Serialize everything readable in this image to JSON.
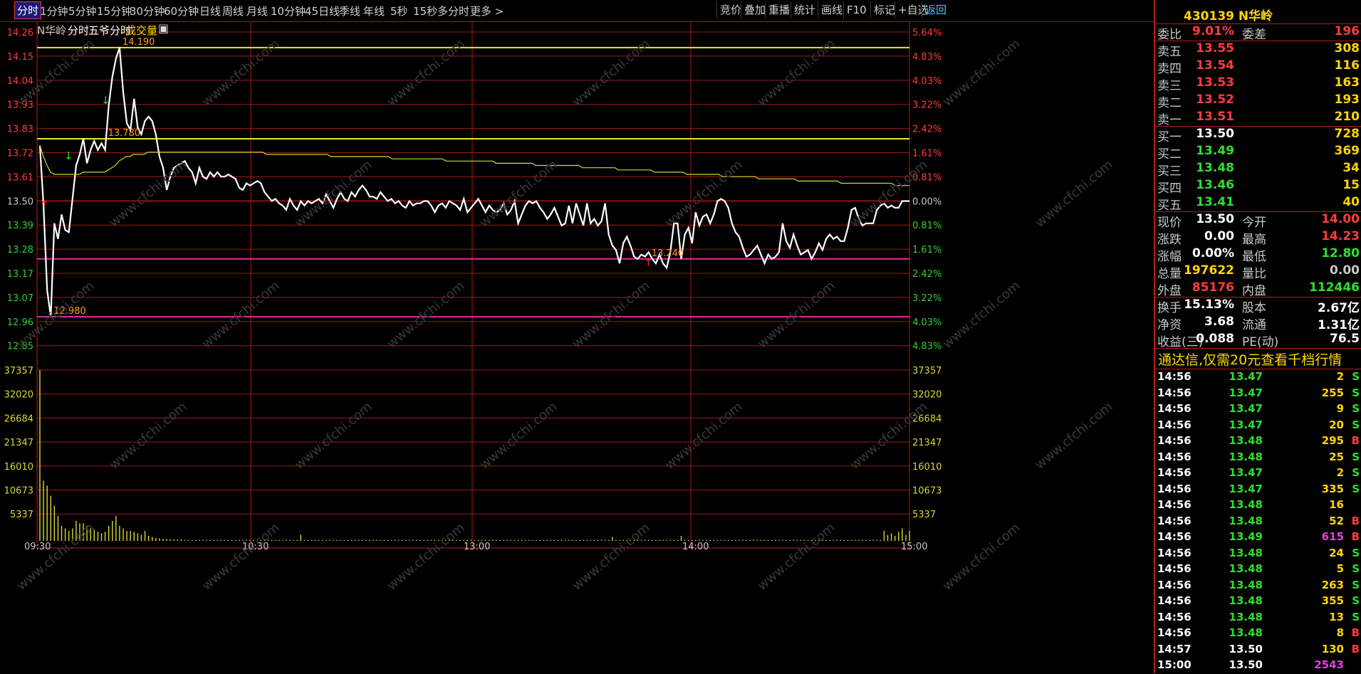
{
  "top_tabs": [
    "分时",
    "1分钟",
    "5分钟",
    "15分钟",
    "30分钟",
    "60分钟",
    "日线",
    "周线",
    "月线",
    "10分钟",
    "45日线",
    "季线",
    "年线",
    "5秒",
    "15秒",
    "多分时",
    "更多 >"
  ],
  "right_buttons": [
    "竞价",
    "叠加",
    "重播",
    "统计",
    "画线",
    "F10",
    "标记",
    "+自选",
    "返回"
  ],
  "header": {
    "name": "N华岭",
    "mode": "分时",
    "five_fen": "五爷分时",
    "volume_label": "成交量"
  },
  "chart_data": {
    "type": "line",
    "price_axis_left": [
      "14.26",
      "14.15",
      "14.04",
      "13.93",
      "13.83",
      "13.72",
      "13.61",
      "13.50",
      "13.39",
      "13.28",
      "13.17",
      "13.07",
      "12.96",
      "12.85"
    ],
    "pct_axis_right": [
      "5.64%",
      "4.83%",
      "4.03%",
      "3.22%",
      "2.42%",
      "1.61%",
      "0.81%",
      "0.00%",
      "0.81%",
      "1.61%",
      "2.42%",
      "3.22%",
      "4.03%",
      "4.83%"
    ],
    "vol_axis": [
      "37357",
      "32020",
      "26684",
      "21347",
      "16010",
      "10673",
      "5337"
    ],
    "time_labels": [
      "09:30",
      "10:30",
      "13:00",
      "14:00",
      "15:00"
    ],
    "prev_close": 13.5,
    "price_range": [
      12.8,
      14.32
    ],
    "annotations": [
      {
        "text": "14.190",
        "price": 14.19,
        "index": 22
      },
      {
        "text": "13.780",
        "price": 13.78,
        "index": 18
      },
      {
        "text": "13.240",
        "price": 13.24,
        "index": 168
      },
      {
        "text": "12.980",
        "price": 12.98,
        "index": 3
      }
    ],
    "series": [
      {
        "color": "#ffffff",
        "values": [
          13.75,
          13.48,
          13.1,
          12.98,
          13.4,
          13.33,
          13.44,
          13.37,
          13.36,
          13.51,
          13.66,
          13.71,
          13.78,
          13.67,
          13.73,
          13.77,
          13.73,
          13.76,
          13.73,
          13.93,
          14.06,
          14.14,
          14.19,
          13.99,
          13.85,
          13.82,
          13.96,
          13.83,
          13.8,
          13.86,
          13.88,
          13.86,
          13.8,
          13.7,
          13.65,
          13.55,
          13.61,
          13.65,
          13.66,
          13.67,
          13.68,
          13.65,
          13.63,
          13.58,
          13.65,
          13.61,
          13.6,
          13.63,
          13.61,
          13.63,
          13.61,
          13.61,
          13.62,
          13.61,
          13.6,
          13.56,
          13.55,
          13.58,
          13.57,
          13.58,
          13.59,
          13.58,
          13.54,
          13.52,
          13.5,
          13.51,
          13.49,
          13.48,
          13.46,
          13.51,
          13.48,
          13.46,
          13.5,
          13.48,
          13.5,
          13.49,
          13.5,
          13.51,
          13.49,
          13.53,
          13.5,
          13.47,
          13.51,
          13.54,
          13.51,
          13.5,
          13.54,
          13.52,
          13.55,
          13.57,
          13.55,
          13.52,
          13.52,
          13.51,
          13.54,
          13.52,
          13.5,
          13.51,
          13.49,
          13.5,
          13.48,
          13.47,
          13.5,
          13.48,
          13.49,
          13.49,
          13.5,
          13.5,
          13.48,
          13.45,
          13.48,
          13.49,
          13.47,
          13.5,
          13.49,
          13.48,
          13.46,
          13.51,
          13.45,
          13.47,
          13.49,
          13.51,
          13.48,
          13.45,
          13.48,
          13.46,
          13.45,
          13.46,
          13.49,
          13.44,
          13.46,
          13.5,
          13.4,
          13.44,
          13.48,
          13.5,
          13.49,
          13.5,
          13.47,
          13.45,
          13.42,
          13.44,
          13.47,
          13.43,
          13.39,
          13.4,
          13.48,
          13.4,
          13.49,
          13.44,
          13.39,
          13.49,
          13.4,
          13.42,
          13.39,
          13.41,
          13.49,
          13.35,
          13.3,
          13.28,
          13.22,
          13.31,
          13.34,
          13.3,
          13.25,
          13.24,
          13.26,
          13.25,
          13.27,
          13.24,
          13.22,
          13.26,
          13.22,
          13.2,
          13.27,
          13.4,
          13.4,
          13.24,
          13.35,
          13.38,
          13.31,
          13.45,
          13.39,
          13.43,
          13.44,
          13.4,
          13.44,
          13.5,
          13.51,
          13.5,
          13.47,
          13.4,
          13.36,
          13.34,
          13.29,
          13.25,
          13.26,
          13.28,
          13.3,
          13.26,
          13.22,
          13.26,
          13.24,
          13.25,
          13.27,
          13.4,
          13.32,
          13.29,
          13.35,
          13.3,
          13.26,
          13.27,
          13.28,
          13.24,
          13.27,
          13.31,
          13.28,
          13.33,
          13.35,
          13.33,
          13.34,
          13.32,
          13.32,
          13.38,
          13.46,
          13.47,
          13.42,
          13.39,
          13.4,
          13.4,
          13.4,
          13.46,
          13.48,
          13.49,
          13.47,
          13.48,
          13.47,
          13.47,
          13.5,
          13.5,
          13.5
        ]
      },
      {
        "color": "#d8d830",
        "values": [
          13.75,
          13.7,
          13.66,
          13.63,
          13.62,
          13.62,
          13.62,
          13.62,
          13.62,
          13.62,
          13.62,
          13.62,
          13.63,
          13.63,
          13.63,
          13.63,
          13.63,
          13.63,
          13.63,
          13.64,
          13.65,
          13.66,
          13.68,
          13.69,
          13.7,
          13.7,
          13.71,
          13.71,
          13.71,
          13.71,
          13.72,
          13.72,
          13.72,
          13.72,
          13.72,
          13.72,
          13.72,
          13.72,
          13.72,
          13.72,
          13.72,
          13.72,
          13.72,
          13.72,
          13.72,
          13.72,
          13.72,
          13.72,
          13.72,
          13.72,
          13.72,
          13.72,
          13.72,
          13.72,
          13.72,
          13.72,
          13.72,
          13.72,
          13.72,
          13.72,
          13.72,
          13.72,
          13.72,
          13.71,
          13.71,
          13.71,
          13.71,
          13.71,
          13.71,
          13.71,
          13.71,
          13.71,
          13.71,
          13.71,
          13.71,
          13.71,
          13.71,
          13.71,
          13.71,
          13.71,
          13.71,
          13.7,
          13.7,
          13.7,
          13.7,
          13.7,
          13.7,
          13.7,
          13.7,
          13.7,
          13.7,
          13.7,
          13.7,
          13.7,
          13.7,
          13.7,
          13.7,
          13.7,
          13.69,
          13.69,
          13.69,
          13.69,
          13.69,
          13.69,
          13.69,
          13.69,
          13.69,
          13.69,
          13.69,
          13.69,
          13.69,
          13.69,
          13.69,
          13.68,
          13.68,
          13.68,
          13.68,
          13.68,
          13.68,
          13.68,
          13.68,
          13.68,
          13.68,
          13.68,
          13.68,
          13.68,
          13.68,
          13.67,
          13.67,
          13.67,
          13.67,
          13.67,
          13.67,
          13.67,
          13.67,
          13.67,
          13.67,
          13.67,
          13.66,
          13.66,
          13.66,
          13.66,
          13.66,
          13.66,
          13.66,
          13.66,
          13.66,
          13.66,
          13.66,
          13.66,
          13.66,
          13.65,
          13.65,
          13.65,
          13.65,
          13.65,
          13.65,
          13.65,
          13.65,
          13.65,
          13.65,
          13.64,
          13.64,
          13.64,
          13.64,
          13.64,
          13.64,
          13.64,
          13.64,
          13.64,
          13.64,
          13.63,
          13.63,
          13.63,
          13.63,
          13.63,
          13.63,
          13.63,
          13.63,
          13.63,
          13.62,
          13.62,
          13.62,
          13.62,
          13.62,
          13.62,
          13.62,
          13.62,
          13.62,
          13.62,
          13.61,
          13.61,
          13.61,
          13.61,
          13.61,
          13.61,
          13.61,
          13.61,
          13.61,
          13.61,
          13.6,
          13.6,
          13.6,
          13.6,
          13.6,
          13.6,
          13.6,
          13.6,
          13.6,
          13.6,
          13.6,
          13.59,
          13.59,
          13.59,
          13.59,
          13.59,
          13.59,
          13.59,
          13.59,
          13.59,
          13.59,
          13.59,
          13.59,
          13.58,
          13.58,
          13.58,
          13.58,
          13.58,
          13.58,
          13.58,
          13.58,
          13.58,
          13.58,
          13.58,
          13.58,
          13.58,
          13.58,
          13.58,
          13.57,
          13.57,
          13.57,
          13.57,
          13.57
        ]
      }
    ],
    "volume": [
      34000,
      12000,
      11000,
      9000,
      7000,
      5000,
      3000,
      2500,
      2000,
      2500,
      4000,
      3500,
      3500,
      3000,
      2500,
      2200,
      1800,
      1500,
      1800,
      3000,
      4000,
      5000,
      3000,
      2500,
      2000,
      2000,
      1800,
      1500,
      1200,
      2000,
      1000,
      800,
      600,
      500,
      400,
      400,
      300,
      300,
      300,
      300,
      200,
      200,
      200,
      200,
      200,
      200,
      200,
      200,
      200,
      200,
      200,
      200,
      200,
      200,
      200,
      200,
      200,
      200,
      200,
      200,
      200,
      200,
      200,
      200,
      200,
      200,
      200,
      200,
      200,
      200,
      200,
      200,
      1200,
      200,
      200,
      200,
      200,
      200,
      200,
      200,
      200,
      200,
      200,
      200,
      200,
      200,
      200,
      200,
      200,
      200,
      200,
      200,
      200,
      200,
      200,
      200,
      200,
      200,
      200,
      200,
      200,
      200,
      200,
      200,
      200,
      200,
      200,
      200,
      200,
      200,
      200,
      200,
      200,
      200,
      200,
      200,
      200,
      200,
      200,
      200,
      200,
      200,
      200,
      200,
      200,
      200,
      200,
      200,
      200,
      200,
      200,
      200,
      200,
      200,
      200,
      200,
      200,
      200,
      200,
      200,
      200,
      200,
      200,
      200,
      200,
      200,
      200,
      200,
      200,
      200,
      200,
      200,
      200,
      200,
      200,
      200,
      200,
      200,
      800,
      200,
      200,
      200,
      200,
      200,
      200,
      200,
      200,
      200,
      200,
      200,
      200,
      200,
      200,
      200,
      200,
      200,
      200,
      1000,
      200,
      200,
      200,
      200,
      200,
      200,
      200,
      200,
      200,
      200,
      200,
      200,
      200,
      200,
      200,
      200,
      200,
      200,
      200,
      200,
      200,
      200,
      200,
      200,
      200,
      200,
      200,
      200,
      200,
      200,
      200,
      200,
      200,
      200,
      200,
      200,
      200,
      200,
      200,
      200,
      200,
      200,
      200,
      200,
      200,
      200,
      200,
      200,
      200,
      200,
      200,
      200,
      200,
      200,
      200,
      2000,
      1200,
      1500,
      1000,
      1800,
      2500,
      1200,
      2000
    ]
  },
  "quote": {
    "code_name": "430139 N华岭",
    "weibi": {
      "label": "委比",
      "value": "9.01%",
      "label2": "委差",
      "value2": "196"
    },
    "asks": [
      {
        "label": "卖五",
        "price": "13.55",
        "vol": "308"
      },
      {
        "label": "卖四",
        "price": "13.54",
        "vol": "116"
      },
      {
        "label": "卖三",
        "price": "13.53",
        "vol": "163"
      },
      {
        "label": "卖二",
        "price": "13.52",
        "vol": "193"
      },
      {
        "label": "卖一",
        "price": "13.51",
        "vol": "210"
      }
    ],
    "bids": [
      {
        "label": "买一",
        "price": "13.50",
        "vol": "728"
      },
      {
        "label": "买二",
        "price": "13.49",
        "vol": "369"
      },
      {
        "label": "买三",
        "price": "13.48",
        "vol": "34"
      },
      {
        "label": "买四",
        "price": "13.46",
        "vol": "15"
      },
      {
        "label": "买五",
        "price": "13.41",
        "vol": "40"
      }
    ],
    "stats": [
      {
        "l1": "现价",
        "v1": "13.50",
        "l2": "今开",
        "v2": "14.00"
      },
      {
        "l1": "涨跌",
        "v1": "0.00",
        "l2": "最高",
        "v2": "14.23"
      },
      {
        "l1": "涨幅",
        "v1": "0.00%",
        "l2": "最低",
        "v2": "12.80"
      },
      {
        "l1": "总量",
        "v1": "197622",
        "l2": "量比",
        "v2": "0.00"
      },
      {
        "l1": "外盘",
        "v1": "85176",
        "l2": "内盘",
        "v2": "112446"
      }
    ],
    "fin": [
      {
        "l1": "换手",
        "v1": "15.13%",
        "l2": "股本",
        "v2": "2.67亿"
      },
      {
        "l1": "净资",
        "v1": "3.68",
        "l2": "流通",
        "v2": "1.31亿"
      },
      {
        "l1": "收益(三)",
        "v1": "0.088",
        "l2": "PE(动)",
        "v2": "76.5"
      }
    ],
    "notice": "通达信,仅需20元查看千档行情",
    "ticks": [
      {
        "t": "14:56",
        "p": "13.47",
        "v": "2",
        "s": "S"
      },
      {
        "t": "14:56",
        "p": "13.47",
        "v": "255",
        "s": "S"
      },
      {
        "t": "14:56",
        "p": "13.47",
        "v": "9",
        "s": "S"
      },
      {
        "t": "14:56",
        "p": "13.47",
        "v": "20",
        "s": "S"
      },
      {
        "t": "14:56",
        "p": "13.48",
        "v": "295",
        "s": "B"
      },
      {
        "t": "14:56",
        "p": "13.48",
        "v": "25",
        "s": "S"
      },
      {
        "t": "14:56",
        "p": "13.47",
        "v": "2",
        "s": "S"
      },
      {
        "t": "14:56",
        "p": "13.47",
        "v": "335",
        "s": "S"
      },
      {
        "t": "14:56",
        "p": "13.48",
        "v": "16",
        "s": ""
      },
      {
        "t": "14:56",
        "p": "13.48",
        "v": "52",
        "s": "B"
      },
      {
        "t": "14:56",
        "p": "13.49",
        "v": "615",
        "s": "B"
      },
      {
        "t": "14:56",
        "p": "13.48",
        "v": "24",
        "s": "S"
      },
      {
        "t": "14:56",
        "p": "13.48",
        "v": "5",
        "s": "S"
      },
      {
        "t": "14:56",
        "p": "13.48",
        "v": "263",
        "s": "S"
      },
      {
        "t": "14:56",
        "p": "13.48",
        "v": "355",
        "s": "S"
      },
      {
        "t": "14:56",
        "p": "13.48",
        "v": "13",
        "s": "S"
      },
      {
        "t": "14:56",
        "p": "13.48",
        "v": "8",
        "s": "B"
      },
      {
        "t": "14:57",
        "p": "13.50",
        "v": "130",
        "s": "B"
      },
      {
        "t": "15:00",
        "p": "13.50",
        "v": "2543",
        "s": ""
      }
    ]
  }
}
